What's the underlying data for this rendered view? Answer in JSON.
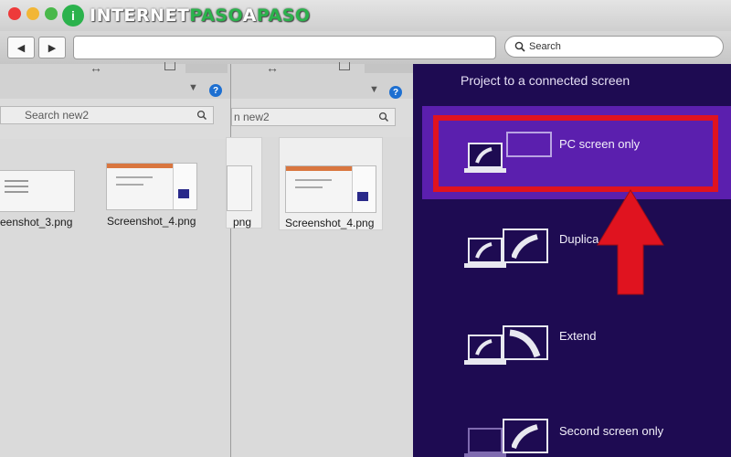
{
  "site": {
    "logo_letter": "i",
    "logo_prefix": "INTERNET",
    "logo_highlight": "PASO",
    "logo_mid": "A",
    "logo_suffix": "PASO"
  },
  "browser": {
    "back_icon": "◀",
    "forward_icon": "▶",
    "search_placeholder": "Search"
  },
  "explorer": {
    "search_text_1": "Search new2",
    "search_text_2": "n new2",
    "file_a": "eenshot_3.png",
    "file_b": "Screenshot_4.png",
    "file_c": "png",
    "file_d": "Screenshot_4.png"
  },
  "project": {
    "title": "Project to a connected screen",
    "options": [
      {
        "label": "PC screen only"
      },
      {
        "label": "Duplica"
      },
      {
        "label": "Extend"
      },
      {
        "label": "Second screen only"
      }
    ]
  },
  "colors": {
    "panel_bg": "#1e0b52",
    "selected_bg": "#5b1fae",
    "highlight": "#e0131f",
    "logo_green": "#2bb24c"
  }
}
